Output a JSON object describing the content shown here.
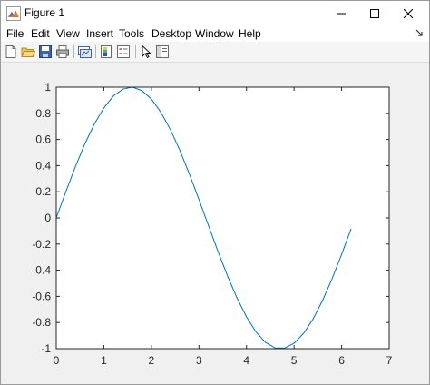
{
  "window": {
    "title": "Figure 1",
    "controls": {
      "minimize": "minimize",
      "maximize": "maximize",
      "close": "close"
    }
  },
  "menu": {
    "items": [
      "File",
      "Edit",
      "View",
      "Insert",
      "Tools",
      "Desktop",
      "Window",
      "Help"
    ]
  },
  "toolbar": {
    "icons": [
      "new-figure-icon",
      "open-file-icon",
      "save-icon",
      "print-icon",
      "link-plot-icon",
      "colorbar-icon",
      "legend-icon",
      "pointer-icon",
      "property-inspector-icon"
    ]
  },
  "colors": {
    "line": "#0072bd",
    "axes_bg": "#ffffff",
    "figure_bg": "#f0f0f0"
  },
  "chart_data": {
    "type": "line",
    "title": "",
    "xlabel": "",
    "ylabel": "",
    "xlim": [
      0,
      7
    ],
    "ylim": [
      -1,
      1
    ],
    "xticks": [
      "0",
      "1",
      "2",
      "3",
      "4",
      "5",
      "6",
      "7"
    ],
    "yticks": [
      "-1",
      "-0.8",
      "-0.6",
      "-0.4",
      "-0.2",
      "0",
      "0.2",
      "0.4",
      "0.6",
      "0.8",
      "1"
    ],
    "grid": false,
    "series": [
      {
        "function": "sin(x)",
        "x": [
          0,
          0.2,
          0.4,
          0.6,
          0.8,
          1.0,
          1.2,
          1.4,
          1.6,
          1.8,
          2.0,
          2.2,
          2.4,
          2.6,
          2.8,
          3.0,
          3.2,
          3.4,
          3.6,
          3.8,
          4.0,
          4.2,
          4.4,
          4.6,
          4.8,
          5.0,
          5.2,
          5.4,
          5.6,
          5.8,
          6.0,
          6.2
        ],
        "y": [
          0,
          0.199,
          0.389,
          0.565,
          0.717,
          0.841,
          0.932,
          0.985,
          1.0,
          0.974,
          0.909,
          0.808,
          0.675,
          0.516,
          0.335,
          0.141,
          -0.058,
          -0.256,
          -0.443,
          -0.612,
          -0.757,
          -0.872,
          -0.952,
          -0.994,
          -0.996,
          -0.959,
          -0.883,
          -0.773,
          -0.631,
          -0.465,
          -0.279,
          -0.083
        ]
      }
    ]
  }
}
